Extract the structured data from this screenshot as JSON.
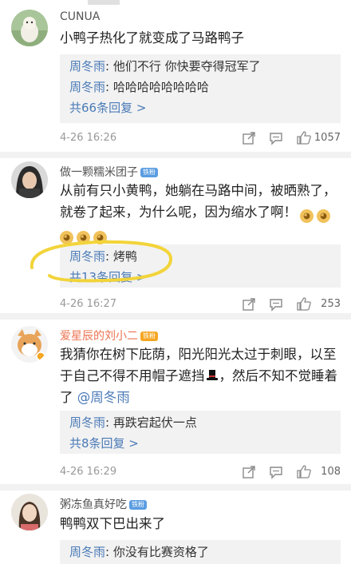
{
  "comments": [
    {
      "username": "CUNUA",
      "text": "小鸭子热化了就变成了马路鸭子",
      "replies": [
        {
          "name": "周冬雨",
          "text": ": 他们不行  你快要夺得冠军了"
        },
        {
          "name": "周冬雨",
          "text": ": 哈哈哈哈哈哈哈哈"
        }
      ],
      "more_replies": "共66条回复 >",
      "time": "4-26 16:26",
      "likes": "1057"
    },
    {
      "username": "做一颗糯米团子",
      "badge": "铁粉",
      "text_line1": "从前有只小黄鸭，她躺在马路中间，被晒熟了，",
      "text_line2": "就卷了起来，为什么呢，因为缩水了啊！",
      "replies": [
        {
          "name": "周冬雨",
          "text": ": 烤鸭"
        }
      ],
      "more_replies": "共13条回复 >",
      "time": "4-26 16:27",
      "likes": "253"
    },
    {
      "username": "爱星辰的刘小二",
      "badge": "铁粉",
      "text_line1": "我猜你在树下庇荫，阳光阳光太过于刺眼，以至",
      "text_line2": "于自己不得不用帽子遮挡",
      "text_line2b": "，然后不知不觉睡着",
      "text_line3": "了",
      "mention": "@周冬雨",
      "replies": [
        {
          "name": "周冬雨",
          "text": ": 再跌宕起伏一点"
        }
      ],
      "more_replies": "共8条回复 >",
      "time": "4-26 16:29",
      "likes": "108"
    },
    {
      "username": "粥冻鱼真好吃",
      "badge": "铁粉",
      "text": "鸭鸭双下巴出来了",
      "replies": [
        {
          "name": "周冬雨",
          "text": ": 你没有比赛资格了"
        }
      ]
    }
  ],
  "icons": [
    "share-icon",
    "comment-icon",
    "like-icon",
    "emoji-icon",
    "top-hat-icon"
  ],
  "colors": {
    "link": "#4a7ab7",
    "orange_name": "#eb7350",
    "highlight": "#f2d43a",
    "reply_bg": "#f2f2f2"
  }
}
